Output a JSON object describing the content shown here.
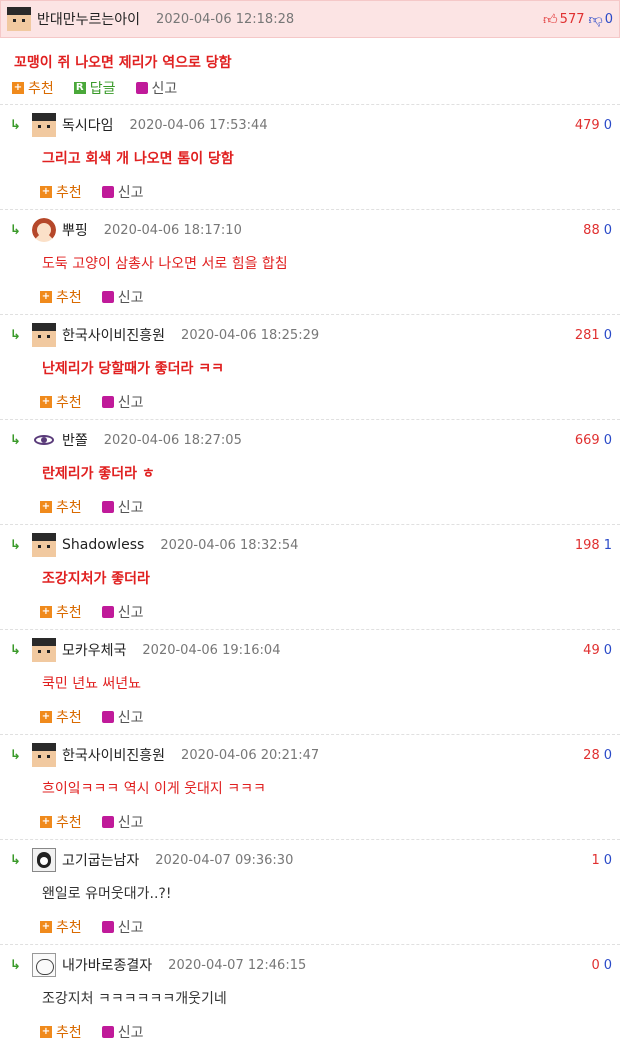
{
  "post": {
    "nickname": "반대만누르는아이",
    "date": "2020-04-06 12:18:28",
    "up_votes": "577",
    "down_votes": "0",
    "text": "꼬맹이 쥐 나오면 제리가 역으로 당함",
    "recommend_label": "추천",
    "reply_label": "답글",
    "report_label": "신고"
  },
  "icons": {
    "thumb_up": "thumbs-up-icon",
    "thumb_down": "thumbs-down-icon",
    "reply_arrow": "reply-arrow-icon",
    "recommend": "plus-icon",
    "reply": "r-badge-icon",
    "report": "siren-icon"
  },
  "colors": {
    "highlight_bg": "#fce4e4",
    "up": "#e03030",
    "down": "#2a4ac8",
    "accent_orange": "#f08a1c",
    "report_magenta": "#c01a9a"
  },
  "replies": [
    {
      "nickname": "독시다임",
      "date": "2020-04-06 17:53:44",
      "up": "479",
      "down": "0",
      "text": "그리고 회색 개 나오면 톰이 당함",
      "style": "red-bold",
      "avatar": "hat"
    },
    {
      "nickname": "뿌핑",
      "date": "2020-04-06 18:17:10",
      "up": "88",
      "down": "0",
      "text": "도둑 고양이 삼총사 나오면 서로 힘을 합침",
      "style": "red",
      "avatar": "girl"
    },
    {
      "nickname": "한국사이비진흥원",
      "date": "2020-04-06 18:25:29",
      "up": "281",
      "down": "0",
      "text": "난제리가 당할때가 좋더라 ㅋㅋ",
      "style": "red-bold",
      "avatar": "hat"
    },
    {
      "nickname": "반쫄",
      "date": "2020-04-06 18:27:05",
      "up": "669",
      "down": "0",
      "text": "란제리가 좋더라 ㅎ",
      "style": "red-bold",
      "avatar": "eye"
    },
    {
      "nickname": "Shadowless",
      "date": "2020-04-06 18:32:54",
      "up": "198",
      "down": "1",
      "text": "조강지처가 좋더라",
      "style": "red-bold",
      "avatar": "hat"
    },
    {
      "nickname": "모카우체국",
      "date": "2020-04-06 19:16:04",
      "up": "49",
      "down": "0",
      "text": "쿡민 년뇨 써년뇨",
      "style": "red",
      "avatar": "hat"
    },
    {
      "nickname": "한국사이비진흥원",
      "date": "2020-04-06 20:21:47",
      "up": "28",
      "down": "0",
      "text": "흐이잌ㅋㅋㅋ 역시 이게 웃대지 ㅋㅋㅋ",
      "style": "red",
      "avatar": "hat"
    },
    {
      "nickname": "고기굽는남자",
      "date": "2020-04-07 09:36:30",
      "up": "1",
      "down": "0",
      "text": "왠일로 유머웃대가..?!",
      "style": "black",
      "avatar": "bw"
    },
    {
      "nickname": "내가바로종결자",
      "date": "2020-04-07 12:46:15",
      "up": "0",
      "down": "0",
      "text": "조강지처 ㅋㅋㅋㅋㅋㅋ개웃기네",
      "style": "black",
      "avatar": "cat"
    }
  ]
}
